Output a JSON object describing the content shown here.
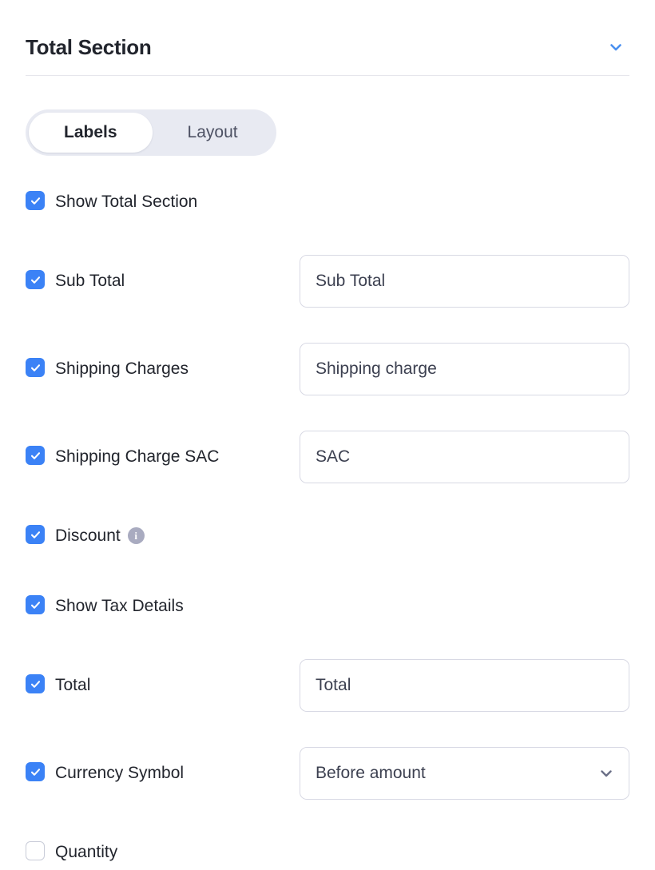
{
  "header": {
    "title": "Total Section",
    "collapse_icon": "chevron-down-icon",
    "collapse_color": "#4a90f0"
  },
  "tabs": {
    "items": [
      {
        "label": "Labels",
        "active": true
      },
      {
        "label": "Layout",
        "active": false
      }
    ]
  },
  "options": [
    {
      "name": "show-total-section",
      "label": "Show Total Section",
      "checked": true,
      "field": null
    },
    {
      "name": "sub-total",
      "label": "Sub Total",
      "checked": true,
      "field": {
        "type": "text",
        "value": "Sub Total"
      }
    },
    {
      "name": "shipping-charges",
      "label": "Shipping Charges",
      "checked": true,
      "field": {
        "type": "text",
        "value": "Shipping charge"
      }
    },
    {
      "name": "shipping-charge-sac",
      "label": "Shipping Charge SAC",
      "checked": true,
      "field": {
        "type": "text",
        "value": "SAC"
      }
    },
    {
      "name": "discount",
      "label": "Discount",
      "checked": true,
      "info": true,
      "field": null
    },
    {
      "name": "show-tax-details",
      "label": "Show Tax Details",
      "checked": true,
      "field": null
    },
    {
      "name": "total",
      "label": "Total",
      "checked": true,
      "field": {
        "type": "text",
        "value": "Total"
      }
    },
    {
      "name": "currency-symbol",
      "label": "Currency Symbol",
      "checked": true,
      "field": {
        "type": "select",
        "value": "Before amount"
      }
    },
    {
      "name": "quantity",
      "label": "Quantity",
      "checked": false,
      "field": null
    }
  ],
  "colors": {
    "checkbox_checked": "#3b82f6",
    "tab_group_bg": "#e8eaf2",
    "info_icon": "#a9abc0",
    "divider": "#e6e6ec",
    "field_border": "#d8d9e4"
  },
  "icons": {
    "check": "check-icon",
    "info": "info-icon",
    "select_chevron": "chevron-down-icon"
  }
}
